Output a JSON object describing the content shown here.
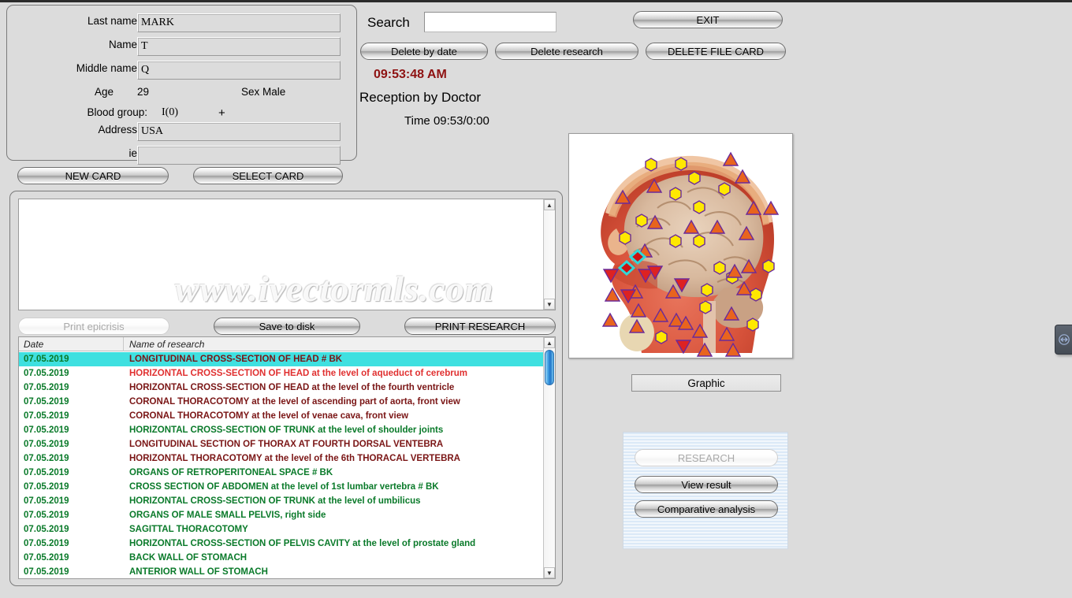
{
  "patient": {
    "fields": [
      {
        "label": "Last name",
        "value": "MARK",
        "name": "last-name"
      },
      {
        "label": "Name",
        "value": "T",
        "name": "first-name"
      },
      {
        "label": "Middle name",
        "value": "Q",
        "name": "middle-name"
      },
      {
        "label": "Address",
        "value": "USA",
        "name": "address"
      },
      {
        "label": "ie",
        "value": "",
        "name": "ie"
      }
    ],
    "age_label": "Age",
    "age_value": "29",
    "sex_label": "Sex Male",
    "blood_label": "Blood group:",
    "blood_value": "I(0)",
    "rh_value": "+",
    "new_card_label": "NEW CARD",
    "select_card_label": "SELECT CARD"
  },
  "toolbar": {
    "search_label": "Search",
    "search_value": "",
    "exit_label": "EXIT",
    "delete_by_date_label": "Delete by date",
    "delete_research_label": "Delete research",
    "delete_file_card_label": "DELETE FILE CARD",
    "clock": "09:53:48 AM",
    "reception_label": "Reception by Doctor",
    "reception_time": "Time 09:53/0:00"
  },
  "epicrisis": {
    "text": "",
    "print_epicrisis_label": "Print epicrisis",
    "save_to_disk_label": "Save to disk",
    "print_research_label": "PRINT RESEARCH"
  },
  "research_list": {
    "columns": [
      "Date",
      "Name of research"
    ],
    "rows": [
      {
        "date": "07.05.2019",
        "name": "LONGITUDINAL CROSS-SECTION OF HEAD # BK",
        "color": "#7a1515",
        "selected": true
      },
      {
        "date": "07.05.2019",
        "name": "HORIZONTAL CROSS-SECTION OF HEAD at the level of aqueduct of cerebrum",
        "color": "#e03030",
        "selected": false
      },
      {
        "date": "07.05.2019",
        "name": "HORIZONTAL CROSS-SECTION OF HEAD at the level of the fourth ventricle",
        "color": "#7a1515",
        "selected": false
      },
      {
        "date": "07.05.2019",
        "name": "CORONAL THORACOTOMY at the level of ascending part of aorta, front view",
        "color": "#7a1515",
        "selected": false
      },
      {
        "date": "07.05.2019",
        "name": "CORONAL THORACOTOMY at the level of venae cava, front view",
        "color": "#7a1515",
        "selected": false
      },
      {
        "date": "07.05.2019",
        "name": "HORIZONTAL CROSS-SECTION OF TRUNK at the level of shoulder joints",
        "color": "#0a7a2a",
        "selected": false
      },
      {
        "date": "07.05.2019",
        "name": "LONGITUDINAL  SECTION  OF  THORAX  AT  FOURTH  DORSAL  VENTEBRA",
        "color": "#7a1515",
        "selected": false
      },
      {
        "date": "07.05.2019",
        "name": "HORIZONTAL THORACOTOMY at the level of the 6th THORACAL VERTEBRA",
        "color": "#7a1515",
        "selected": false
      },
      {
        "date": "07.05.2019",
        "name": "ORGANS OF RETROPERITONEAL SPACE # BK",
        "color": "#0a7a2a",
        "selected": false
      },
      {
        "date": "07.05.2019",
        "name": "CROSS SECTION OF ABDOMEN at the level of 1st lumbar vertebra # BK",
        "color": "#0a7a2a",
        "selected": false
      },
      {
        "date": "07.05.2019",
        "name": "HORIZONTAL CROSS-SECTION OF TRUNK at the level of umbilicus",
        "color": "#0a7a2a",
        "selected": false
      },
      {
        "date": "07.05.2019",
        "name": "ORGANS OF MALE SMALL PELVIS, right side",
        "color": "#0a7a2a",
        "selected": false
      },
      {
        "date": "07.05.2019",
        "name": "SAGITTAL THORACOTOMY",
        "color": "#0a7a2a",
        "selected": false
      },
      {
        "date": "07.05.2019",
        "name": "HORIZONTAL CROSS-SECTION OF PELVIS CAVITY at the level of prostate gland",
        "color": "#0a7a2a",
        "selected": false
      },
      {
        "date": "07.05.2019",
        "name": "BACK WALL OF STOMACH",
        "color": "#0a7a2a",
        "selected": false
      },
      {
        "date": "07.05.2019",
        "name": "ANTERIOR  WALL  OF  STOMACH",
        "color": "#0a7a2a",
        "selected": false
      }
    ]
  },
  "viewer": {
    "graphic_label": "Graphic",
    "research_label": "RESEARCH",
    "view_result_label": "View result",
    "comparative_analysis_label": "Comparative analysis"
  },
  "watermark": "www.ivectormls.com",
  "colors": {
    "selection": "#3fe0e0",
    "clock": "#8e1212",
    "marker_hexagon": "#ffe800",
    "marker_triangle": "#e8641e",
    "marker_diamond": "#cc1111",
    "diamond_outline": "#2fd8d8"
  }
}
